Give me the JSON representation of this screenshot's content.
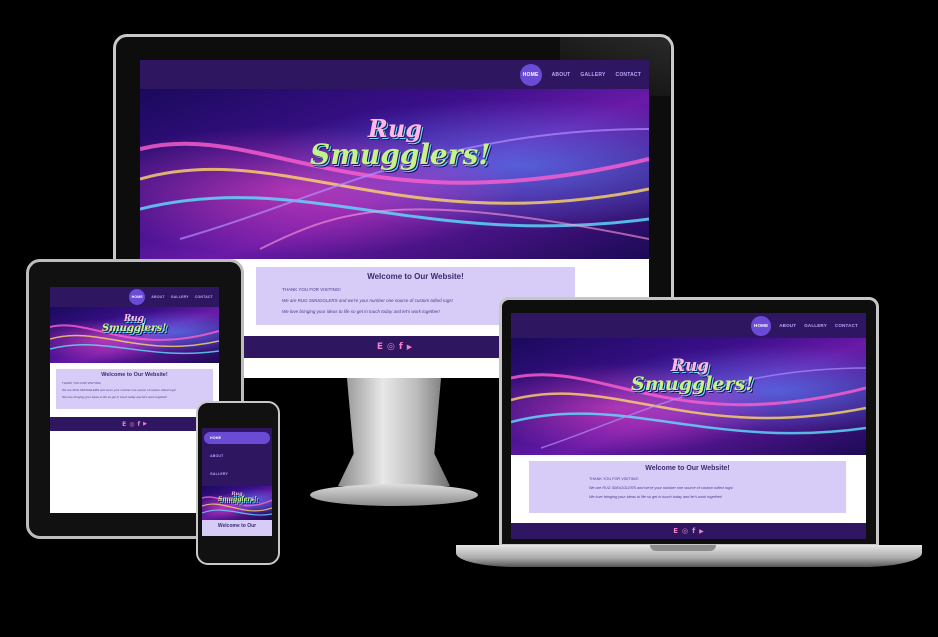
{
  "site": {
    "nav": [
      "Home",
      "About",
      "Gallery",
      "Contact"
    ],
    "logo_line1": "Rug",
    "logo_line2": "Smugglers!",
    "welcome_title": "Welcome to Our Website!",
    "thank_you": "THANK YOU FOR VISITING!",
    "intro": "We are RUG SMUGGLERS and we're your number one source of custom tufted rugs!",
    "cta": "We love bringing your ideas to life so get in touch today and let's work together!",
    "footer_icons": [
      "Etsy",
      "Instagram",
      "Facebook",
      "YouTube"
    ],
    "footer_glyphs": [
      "E",
      "◎",
      "f",
      "▶"
    ]
  },
  "phone": {
    "welcome_title_cut": "Welcome to Our"
  },
  "colors": {
    "nav_bg": "#2e1760",
    "accent": "#6a4bd6",
    "welcome_bg": "#d6ccf7",
    "icon_pink": "#f27fc8"
  }
}
